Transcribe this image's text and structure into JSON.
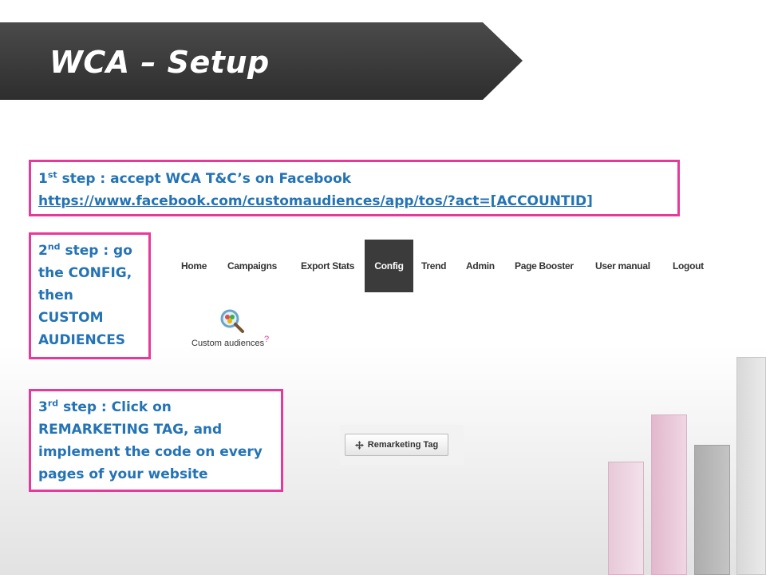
{
  "slide": {
    "title": "WCA – Setup"
  },
  "steps": {
    "step1": {
      "ordinal": "1",
      "ordinal_suffix": "st",
      "text": " step : accept WCA T&C’s on Facebook",
      "link": "https://www.facebook.com/customaudiences/app/tos/?act=[ACCOUNTID]"
    },
    "step2": {
      "ordinal": "2",
      "ordinal_suffix": "nd",
      "line1": " step : go",
      "line2": "the CONFIG,",
      "line3": "then",
      "line4": "CUSTOM",
      "line5": "AUDIENCES"
    },
    "step3": {
      "ordinal": "3",
      "ordinal_suffix": "rd",
      "line1": " step : Click on",
      "line2": "REMARKETING TAG, and",
      "line3": "implement the code on every",
      "line4": "pages of your website"
    }
  },
  "nav": {
    "items": [
      "Home",
      "Campaigns",
      "Export Stats",
      "Config",
      "Trend",
      "Admin",
      "Page Booster",
      "User manual",
      "Logout"
    ],
    "active": "Config"
  },
  "custom_audiences": {
    "label": "Custom audiences",
    "help": "?",
    "icon": "magnifier-icon"
  },
  "remarketing": {
    "label": "Remarketing Tag",
    "icon": "move-arrows-icon"
  },
  "colors": {
    "accent_border": "#e8399b",
    "step_text": "#2373b5",
    "banner": "#3a3a3a",
    "nav_active": "#3b3b3b"
  }
}
